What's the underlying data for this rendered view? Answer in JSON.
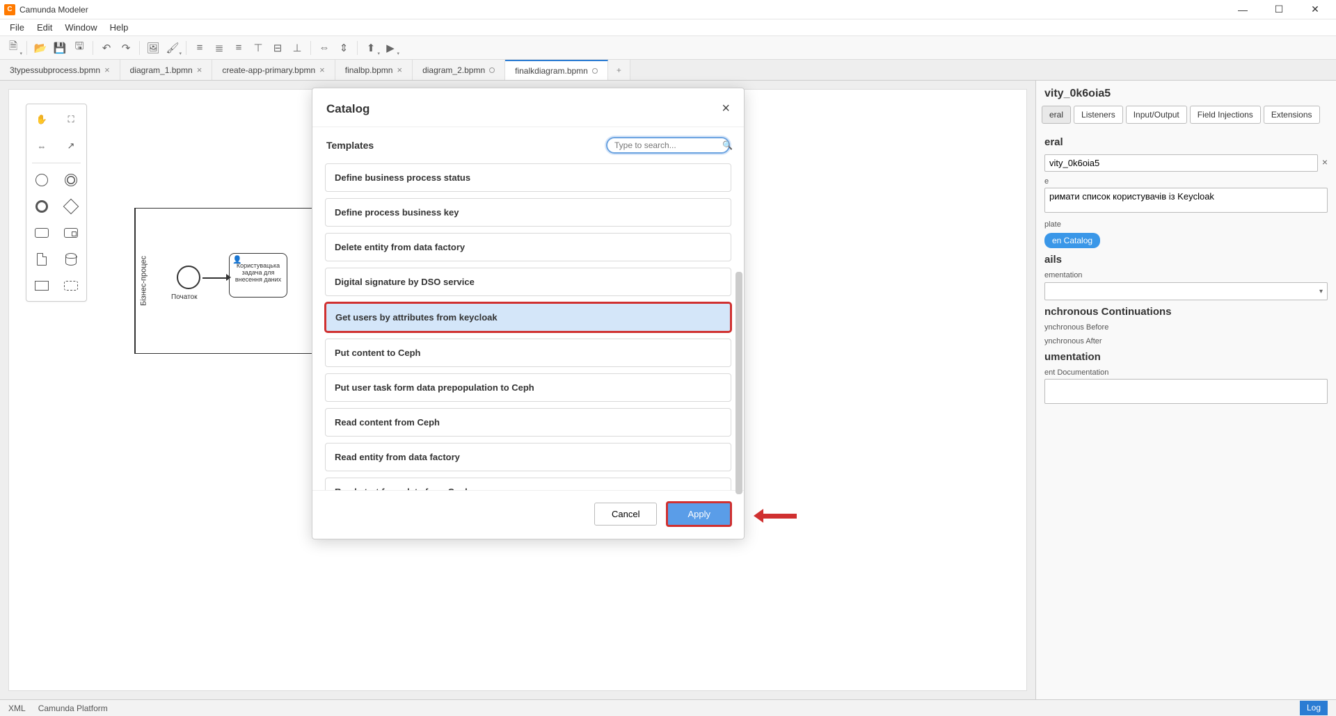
{
  "app": {
    "title": "Camunda Modeler"
  },
  "menu": {
    "file": "File",
    "edit": "Edit",
    "window": "Window",
    "help": "Help"
  },
  "tabs": [
    {
      "label": "3typessubprocess.bpmn",
      "state": "close"
    },
    {
      "label": "diagram_1.bpmn",
      "state": "close"
    },
    {
      "label": "create-app-primary.bpmn",
      "state": "close"
    },
    {
      "label": "finalbp.bpmn",
      "state": "close"
    },
    {
      "label": "diagram_2.bpmn",
      "state": "dirty"
    },
    {
      "label": "finalkdiagram.bpmn",
      "state": "dirty",
      "active": true
    }
  ],
  "diagram": {
    "pool_label": "Бізнес-процес",
    "start_label": "Початок",
    "task_label": "Користувацька задача для внесення даних"
  },
  "props": {
    "header": "vity_0k6oia5",
    "tabs": {
      "general": "eral",
      "listeners": "Listeners",
      "io": "Input/Output",
      "fi": "Field Injections",
      "ext": "Extensions"
    },
    "section_general": "eral",
    "id_value": "vity_0k6oia5",
    "label_e": "e",
    "name_value": "римати список користувачів із Keycloak",
    "label_template": "plate",
    "open_catalog": "en Catalog",
    "section_details": "ails",
    "label_implementation": "ementation",
    "section_async": "nchronous Continuations",
    "label_async_before": "ynchronous Before",
    "label_async_after": "ynchronous After",
    "section_doc": "umentation",
    "label_element_doc": "ent Documentation"
  },
  "modal": {
    "title": "Catalog",
    "sub_title": "Templates",
    "search_placeholder": "Type to search...",
    "templates": [
      "Define business process status",
      "Define process business key",
      "Delete entity from data factory",
      "Digital signature by DSO service",
      "Get users by attributes from keycloak",
      "Put content to Ceph",
      "Put user task form data prepopulation to Ceph",
      "Read content from Ceph",
      "Read entity from data factory",
      "Read start form data from Ceph"
    ],
    "selected_index": 4,
    "cancel": "Cancel",
    "apply": "Apply"
  },
  "status": {
    "left1": "XML",
    "left2": "Camunda Platform",
    "log": "Log"
  }
}
